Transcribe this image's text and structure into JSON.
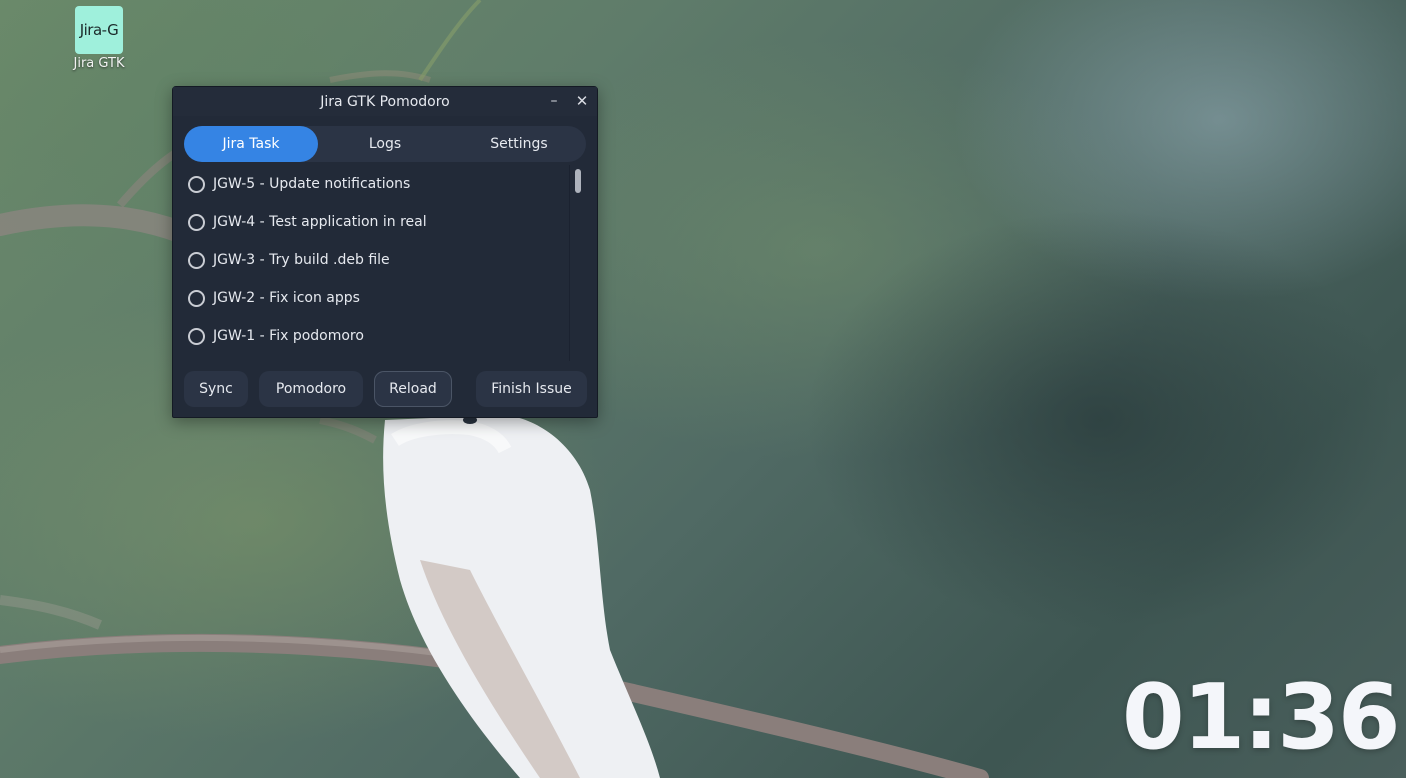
{
  "desktop": {
    "icon": {
      "tile_text": "Jira-G",
      "label": "Jira GTK",
      "tile_color": "#9ff0dc"
    },
    "clock": "01:36"
  },
  "window": {
    "title": "Jira GTK Pomodoro",
    "minimize_glyph": "–",
    "close_glyph": "✕",
    "tabs": [
      {
        "label": "Jira Task",
        "active": true
      },
      {
        "label": "Logs",
        "active": false
      },
      {
        "label": "Settings",
        "active": false
      }
    ],
    "tasks": [
      {
        "label": "JGW-5 - Update notifications"
      },
      {
        "label": "JGW-4 - Test application in real"
      },
      {
        "label": "JGW-3 - Try build .deb file"
      },
      {
        "label": "JGW-2 - Fix icon apps"
      },
      {
        "label": "JGW-1 - Fix podomoro"
      }
    ],
    "buttons": {
      "sync": "Sync",
      "pomodoro": "Pomodoro",
      "reload": "Reload",
      "finish": "Finish Issue"
    },
    "accent_color": "#3584e4",
    "background_color": "#222a38"
  }
}
